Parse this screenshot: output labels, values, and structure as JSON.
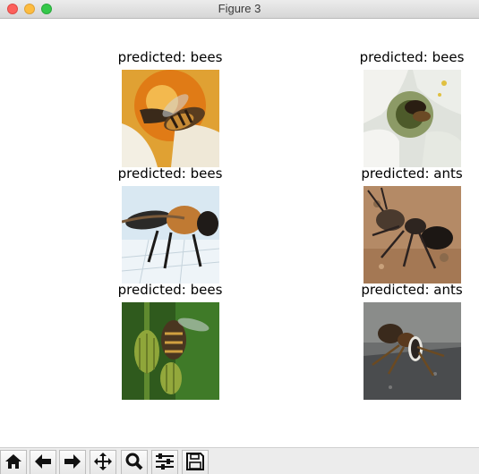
{
  "window": {
    "title": "Figure 3"
  },
  "figure": {
    "panels": [
      {
        "label": "predicted: bees",
        "image": "bee-on-flower"
      },
      {
        "label": "predicted: bees",
        "image": "bee-on-white-flower"
      },
      {
        "label": "predicted: bees",
        "image": "bee-on-surface"
      },
      {
        "label": "predicted: ants",
        "image": "ant-on-ground"
      },
      {
        "label": "predicted: bees",
        "image": "bee-on-buds"
      },
      {
        "label": "predicted: ants",
        "image": "ant-on-rock"
      }
    ]
  },
  "toolbar": {
    "buttons": [
      {
        "name": "home",
        "icon": "home-icon"
      },
      {
        "name": "back",
        "icon": "arrow-left-icon"
      },
      {
        "name": "forward",
        "icon": "arrow-right-icon"
      },
      {
        "name": "pan",
        "icon": "move-icon"
      },
      {
        "name": "zoom",
        "icon": "zoom-icon"
      },
      {
        "name": "configure",
        "icon": "sliders-icon"
      },
      {
        "name": "save",
        "icon": "save-icon"
      }
    ]
  }
}
